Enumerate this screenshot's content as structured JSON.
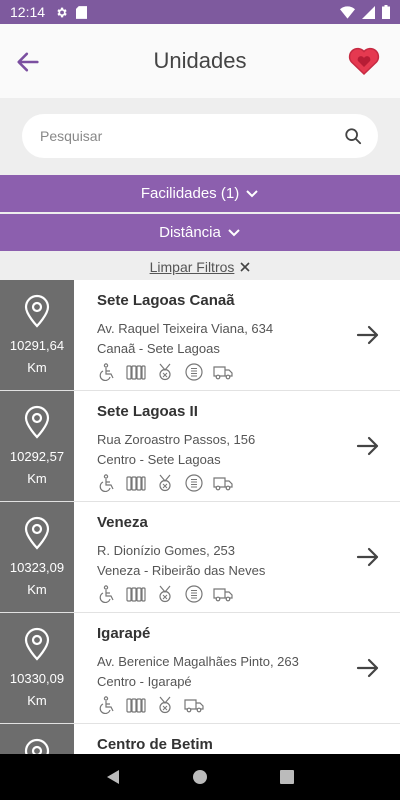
{
  "status_bar": {
    "time": "12:14"
  },
  "header": {
    "title": "Unidades"
  },
  "search": {
    "placeholder": "Pesquisar",
    "value": ""
  },
  "filters": {
    "facilidades_label": "Facilidades (1)",
    "distancia_label": "Distância",
    "clear_label": "Limpar Filtros"
  },
  "units": [
    {
      "name": "Sete Lagoas Canaã",
      "address_line1": "Av. Raquel Teixeira Viana, 634",
      "address_line2": "Canaã - Sete Lagoas",
      "distance": "10291,64",
      "unit": "Km",
      "facilities": [
        "wheelchair-icon",
        "radiator-icon",
        "medal-icon",
        "menu-circle-icon",
        "truck-icon"
      ]
    },
    {
      "name": "Sete Lagoas II",
      "address_line1": "Rua Zoroastro Passos, 156",
      "address_line2": "Centro - Sete Lagoas",
      "distance": "10292,57",
      "unit": "Km",
      "facilities": [
        "wheelchair-icon",
        "radiator-icon",
        "medal-icon",
        "menu-circle-icon",
        "truck-icon"
      ]
    },
    {
      "name": "Veneza",
      "address_line1": "R. Dionízio Gomes, 253",
      "address_line2": "Veneza - Ribeirão das Neves",
      "distance": "10323,09",
      "unit": "Km",
      "facilities": [
        "wheelchair-icon",
        "radiator-icon",
        "medal-icon",
        "menu-circle-icon",
        "truck-icon"
      ]
    },
    {
      "name": "Igarapé",
      "address_line1": "Av. Berenice Magalhães Pinto, 263",
      "address_line2": "Centro - Igarapé",
      "distance": "10330,09",
      "unit": "Km",
      "facilities": [
        "wheelchair-icon",
        "radiator-icon",
        "medal-icon",
        "truck-icon"
      ]
    },
    {
      "name": "Centro de Betim",
      "address_line1": "",
      "address_line2": "",
      "distance": "",
      "unit": "",
      "facilities": []
    }
  ],
  "colors": {
    "status_bar": "#7e5a9e",
    "filter_bar": "#8c5fae",
    "accent": "#7b4fa0",
    "distance_panel": "#6d6d6d",
    "heart": "#e53950"
  }
}
